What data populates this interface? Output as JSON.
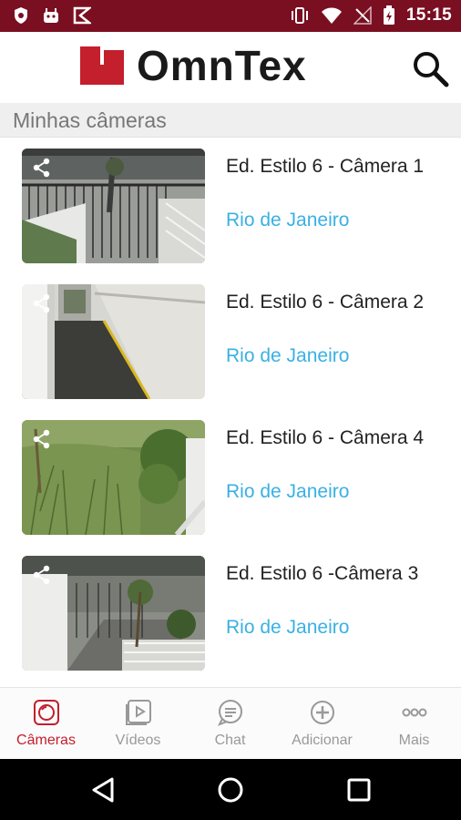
{
  "status_bar": {
    "time": "15:15"
  },
  "header": {
    "brand": "OmnTex"
  },
  "section": {
    "title": "Minhas câmeras"
  },
  "cameras": [
    {
      "title": "Ed. Estilo 6 - Câmera 1",
      "location": "Rio de Janeiro"
    },
    {
      "title": "Ed. Estilo 6 - Câmera 2",
      "location": "Rio de Janeiro"
    },
    {
      "title": "Ed. Estilo 6 - Câmera 4",
      "location": "Rio de Janeiro"
    },
    {
      "title": "Ed. Estilo 6 -Câmera 3",
      "location": "Rio de Janeiro"
    }
  ],
  "bottom_nav": [
    {
      "label": "Câmeras",
      "icon": "camera-icon",
      "active": true
    },
    {
      "label": "Vídeos",
      "icon": "video-icon",
      "active": false
    },
    {
      "label": "Chat",
      "icon": "chat-icon",
      "active": false
    },
    {
      "label": "Adicionar",
      "icon": "add-icon",
      "active": false
    },
    {
      "label": "Mais",
      "icon": "more-icon",
      "active": false
    }
  ],
  "colors": {
    "status_bar": "#7a0f22",
    "brand_red": "#c31f2d",
    "link_blue": "#39b1e3"
  }
}
